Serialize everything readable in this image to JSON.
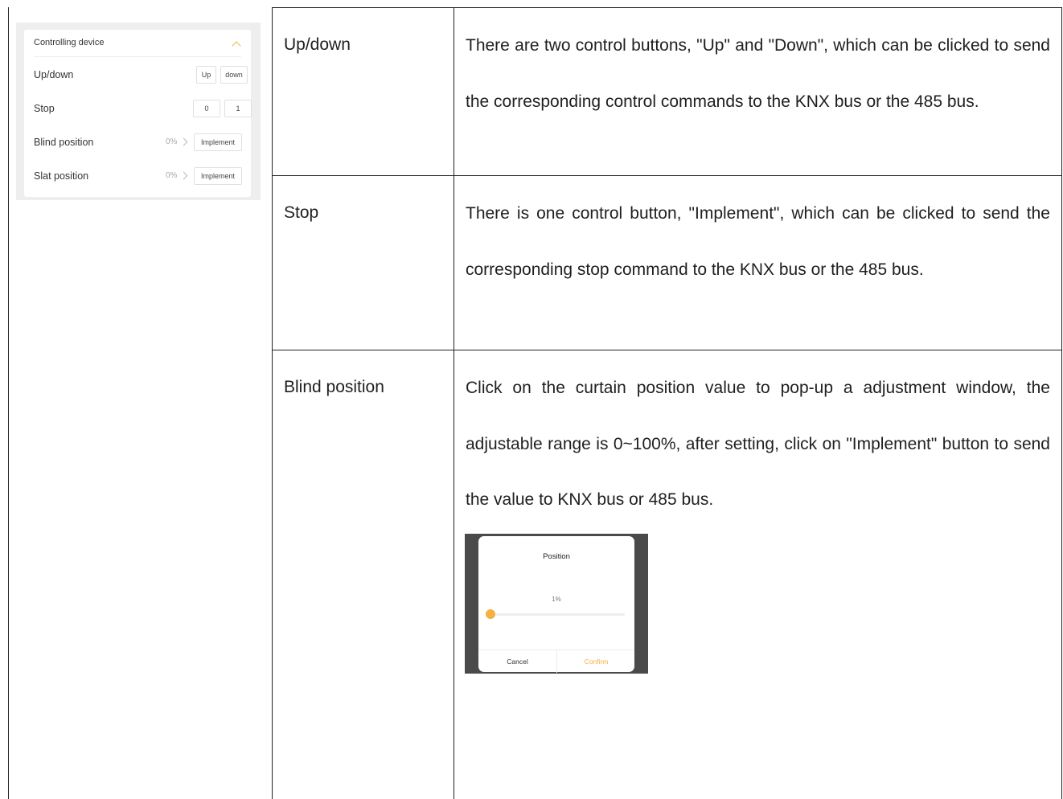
{
  "device_panel": {
    "title": "Controlling device",
    "rows": [
      {
        "label": "Up/down",
        "buttons": [
          "Up",
          "down"
        ]
      },
      {
        "label": "Stop",
        "buttons": [
          "0",
          "1"
        ]
      },
      {
        "label": "Blind position",
        "value": "0%",
        "button": "Implement"
      },
      {
        "label": "Slat position",
        "value": "0%",
        "button": "Implement"
      }
    ]
  },
  "table": {
    "rows": [
      {
        "name": "Up/down",
        "lines": [
          "There are two control buttons, \"Up\" and \"Down\", which can be",
          "clicked to send the corresponding control commands to the KNX",
          "bus or the 485 bus."
        ]
      },
      {
        "name": "Stop",
        "lines": [
          "There is one control button, \"Implement\", which can be clicked to",
          "send the corresponding stop command to the KNX bus or the 485",
          "bus."
        ]
      },
      {
        "name": "Blind position",
        "lines": [
          "Click on the curtain position value to pop-up a adjustment window,",
          "the adjustable range is 0~100%, after setting, click on \"Implement\"",
          "button to send the value to KNX bus or 485 bus."
        ]
      }
    ]
  },
  "popup": {
    "title": "Position",
    "value": "1%",
    "slider_percent": 1,
    "cancel": "Cancel",
    "confirm": "Confirm",
    "accent_color": "#F5B041"
  }
}
